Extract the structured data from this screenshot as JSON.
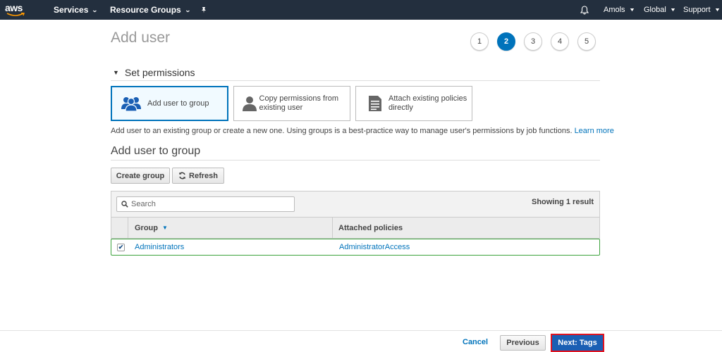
{
  "nav": {
    "logo": "aws",
    "services": "Services",
    "resource_groups": "Resource Groups",
    "user": "Amols",
    "region": "Global",
    "support": "Support"
  },
  "page": {
    "title": "Add user",
    "steps": [
      "1",
      "2",
      "3",
      "4",
      "5"
    ],
    "active_step": 2
  },
  "permissions": {
    "heading": "Set permissions",
    "options": [
      {
        "label": "Add user to group",
        "selected": true,
        "icon": "users-group-icon"
      },
      {
        "label": "Copy permissions from existing user",
        "selected": false,
        "icon": "user-icon"
      },
      {
        "label": "Attach existing policies directly",
        "selected": false,
        "icon": "document-icon"
      }
    ],
    "help_text": "Add user to an existing group or create a new one. Using groups is a best-practice way to manage user's permissions by job functions.",
    "learn_more": "Learn more"
  },
  "group_section": {
    "title": "Add user to group",
    "create_group": "Create group",
    "refresh": "Refresh",
    "search_placeholder": "Search",
    "showing": "Showing 1 result",
    "columns": [
      "Group",
      "Attached policies"
    ],
    "rows": [
      {
        "group": "Administrators",
        "policies": "AdministratorAccess",
        "checked": true
      }
    ]
  },
  "footer": {
    "cancel": "Cancel",
    "previous": "Previous",
    "next": "Next: Tags"
  },
  "colors": {
    "nav_bg": "#232f3e",
    "accent": "#0073bb",
    "next_button": "#1a5fb4",
    "highlight_red": "#e1121f",
    "selected_row_border": "#3da33d"
  }
}
